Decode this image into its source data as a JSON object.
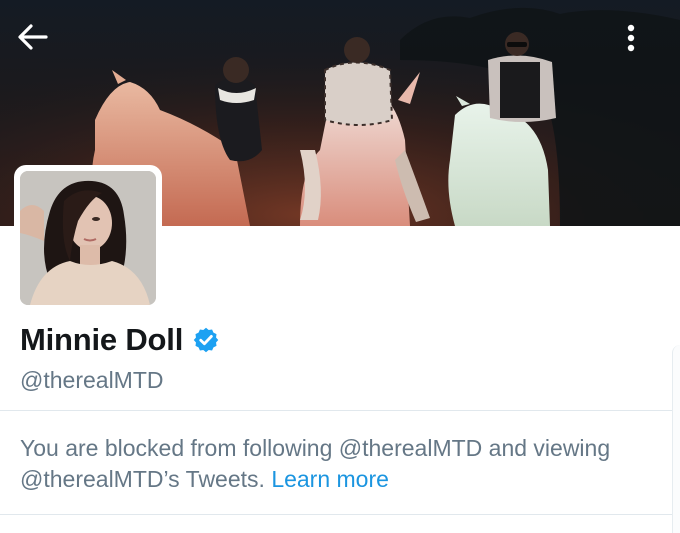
{
  "header": {
    "back_icon": "arrow-left-icon",
    "more_icon": "vertical-dots-icon"
  },
  "profile": {
    "display_name": "Minnie Doll",
    "verified_icon": "verified-badge-icon",
    "verified_color": "#1da1f2",
    "handle": "@therealMTD"
  },
  "notice": {
    "blocked_text": "You are blocked from following @therealMTD and viewing @therealMTD’s Tweets.",
    "learn_more": "Learn more"
  },
  "colors": {
    "text_primary": "#14171a",
    "text_secondary": "#657786",
    "link": "#1b95e0",
    "divider": "#e1e8ed"
  }
}
